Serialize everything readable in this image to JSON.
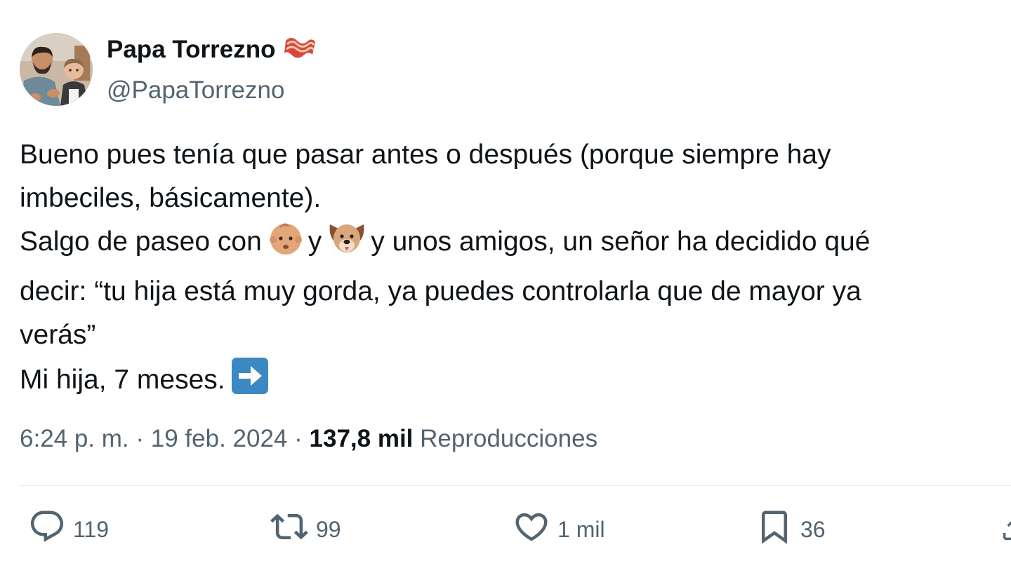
{
  "author": {
    "display_name": "Papa Torrezno",
    "handle": "@PapaTorrezno",
    "name_emoji": "bacon-emoji"
  },
  "tweet": {
    "lines": [
      "Bueno pues tenía que pasar antes o después (porque siempre hay",
      "imbeciles, básicamente).",
      "decir: “tu hija está muy gorda, ya puedes controlarla que de mayor ya",
      "verás”"
    ],
    "line3": {
      "part1": "Salgo de paseo con",
      "part2": "y",
      "part3": "y unos amigos, un señor ha decidido qué",
      "emoji1": "baby-emoji",
      "emoji2": "dog-face-emoji"
    },
    "line6": {
      "text": "Mi hija, 7 meses.",
      "emoji": "right-arrow-emoji"
    }
  },
  "meta": {
    "time": "6:24 p. m.",
    "separator": "·",
    "date": "19 feb. 2024",
    "views_count": "137,8 mil",
    "views_label": "Reproducciones"
  },
  "actions": {
    "replies": "119",
    "retweets": "99",
    "likes": "1 mil",
    "bookmarks": "36"
  },
  "colors": {
    "text_primary": "#0f1419",
    "text_secondary": "#536471",
    "divider": "#e6ecf0",
    "arrow_emoji_bg": "#3b88c3"
  }
}
